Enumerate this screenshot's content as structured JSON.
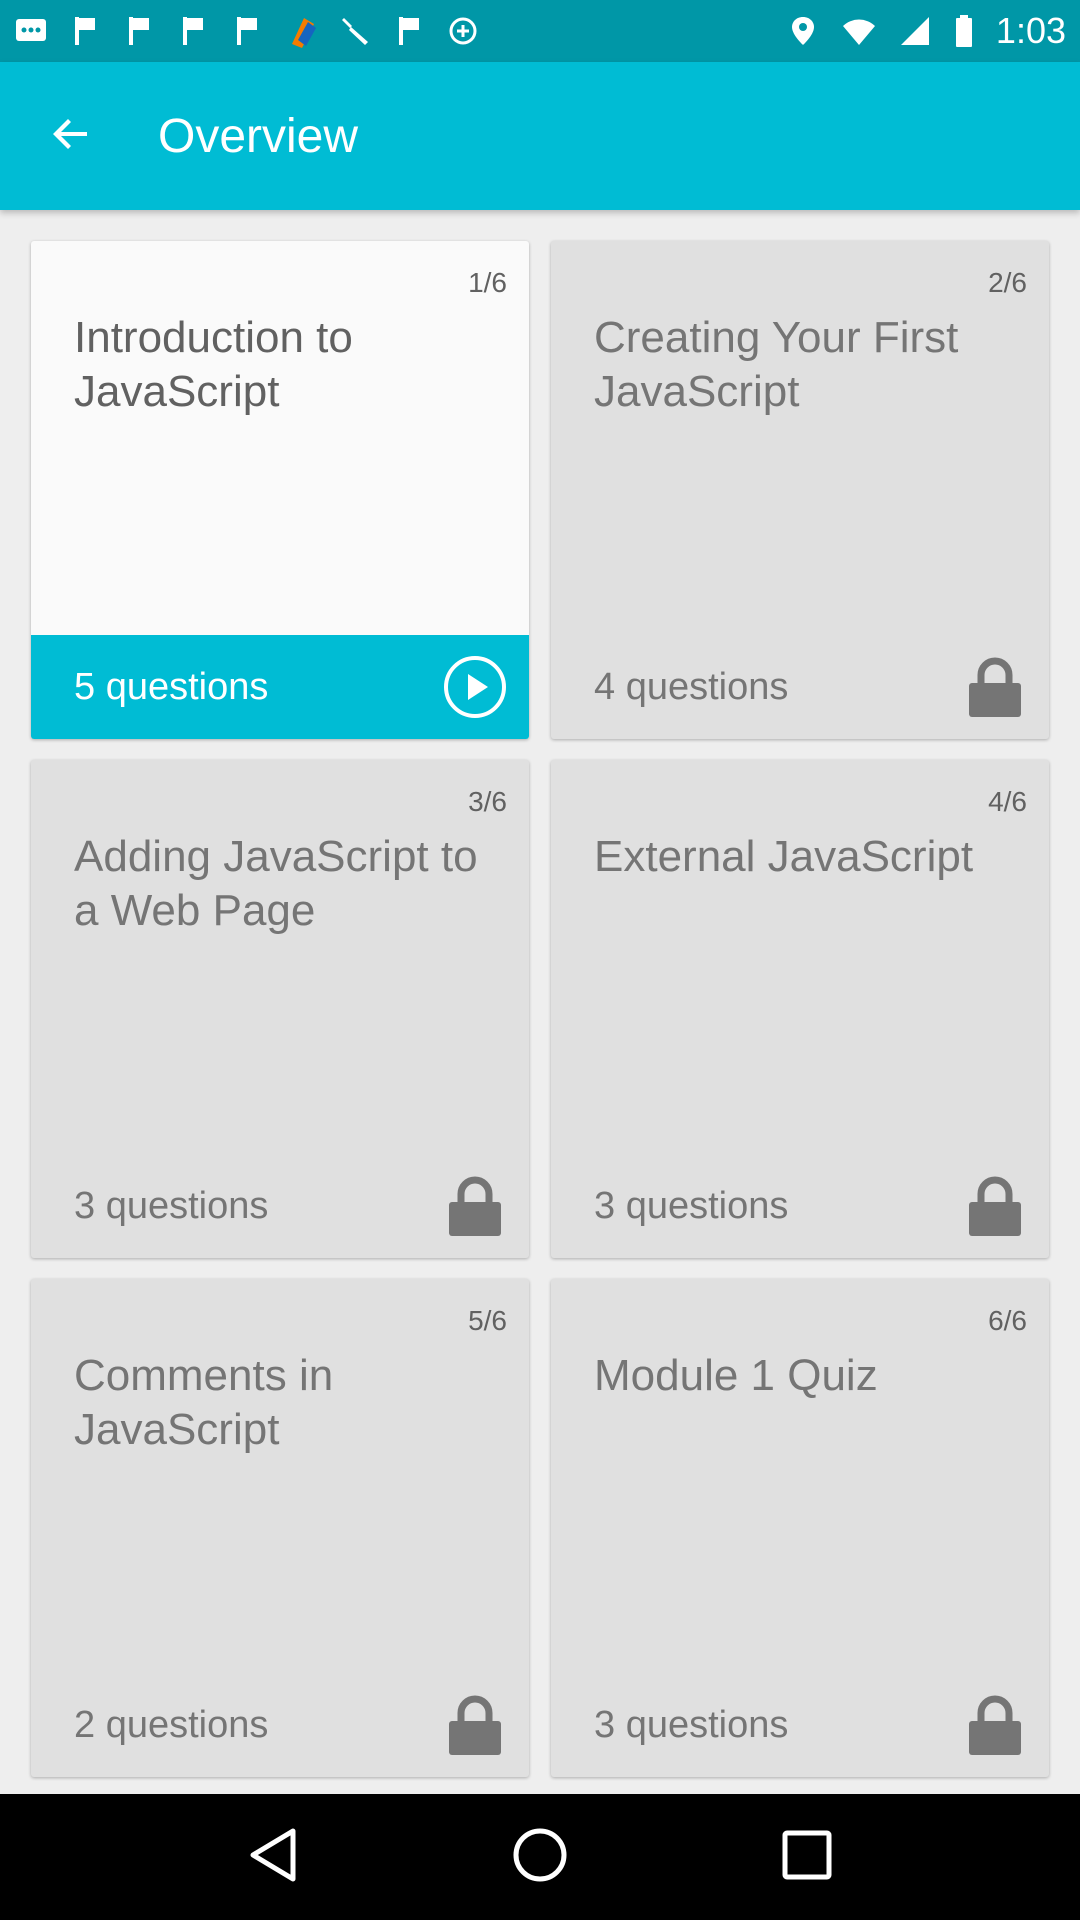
{
  "status_bar": {
    "time": "1:03",
    "left_icons": [
      "messages-icon",
      "flag-icon",
      "flag-icon",
      "flag-icon",
      "flag-icon",
      "app-logo-icon",
      "wrench-icon",
      "flag-icon",
      "data-saver-icon"
    ],
    "right_icons": [
      "location-icon",
      "wifi-icon",
      "signal-icon",
      "battery-icon"
    ]
  },
  "app_bar": {
    "title": "Overview",
    "back_icon": "arrow-back-icon",
    "color": "#00bcd4"
  },
  "cards": [
    {
      "index": "1/6",
      "title": "Introduction to JavaScript",
      "count": "5 questions",
      "state": "unlocked",
      "icon": "play-icon"
    },
    {
      "index": "2/6",
      "title": "Creating Your First JavaScript",
      "count": "4 questions",
      "state": "locked",
      "icon": "lock-icon"
    },
    {
      "index": "3/6",
      "title": "Adding JavaScript to a Web Page",
      "count": "3 questions",
      "state": "locked",
      "icon": "lock-icon"
    },
    {
      "index": "4/6",
      "title": "External JavaScript",
      "count": "3 questions",
      "state": "locked",
      "icon": "lock-icon"
    },
    {
      "index": "5/6",
      "title": "Comments in JavaScript",
      "count": "2 questions",
      "state": "locked",
      "icon": "lock-icon"
    },
    {
      "index": "6/6",
      "title": "Module 1 Quiz",
      "count": "3 questions",
      "state": "locked",
      "icon": "lock-icon"
    }
  ],
  "nav_bar": {
    "buttons": [
      "back-triangle-icon",
      "home-circle-icon",
      "recents-square-icon"
    ]
  }
}
